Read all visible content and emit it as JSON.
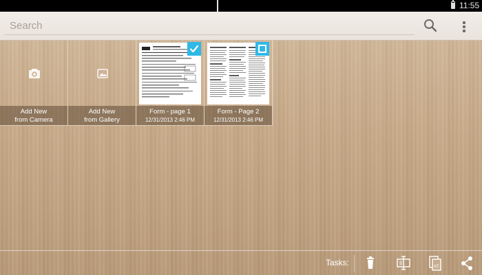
{
  "status_bar": {
    "time": "11:55"
  },
  "search": {
    "placeholder": "Search",
    "value": ""
  },
  "tiles": [
    {
      "title": "Add New",
      "subtitle": "from Camera",
      "icon": "camera-icon"
    },
    {
      "title": "Add New",
      "subtitle": "from Gallery",
      "icon": "gallery-icon"
    },
    {
      "title": "Form - page 1",
      "date": "12/31/2013 2:46 PM",
      "selected": true
    },
    {
      "title": "Form - Page 2",
      "date": "12/31/2013 2:46 PM",
      "selected": false
    }
  ],
  "bottom_bar": {
    "tasks_label": "Tasks:",
    "actions": [
      "delete-icon",
      "ocr-icon",
      "duplicate-icon",
      "share-icon"
    ]
  },
  "colors": {
    "accent": "#2fb8e8",
    "caption_bg": "#5f4b37",
    "search_bar": "#eee9e3"
  }
}
